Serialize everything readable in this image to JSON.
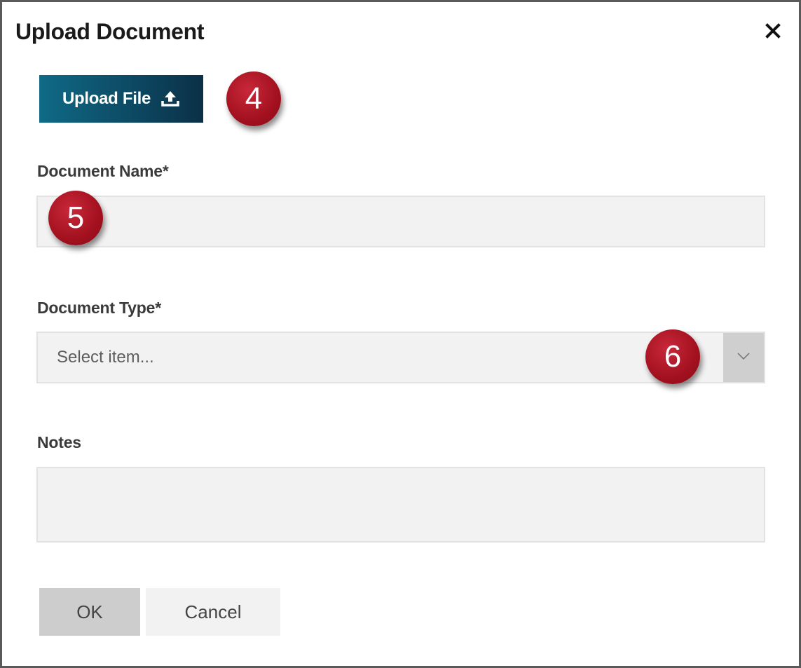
{
  "dialog": {
    "title": "Upload Document",
    "close_glyph": "✕"
  },
  "upload": {
    "label": "Upload File",
    "icon": "upload-icon"
  },
  "fields": {
    "document_name": {
      "label": "Document Name*",
      "value": ""
    },
    "document_type": {
      "label": "Document Type*",
      "placeholder": "Select item...",
      "icon": "chevron-down-icon"
    },
    "notes": {
      "label": "Notes",
      "value": ""
    }
  },
  "callouts": [
    "4",
    "5",
    "6"
  ],
  "buttons": {
    "ok": "OK",
    "cancel": "Cancel"
  },
  "colors": {
    "upload_button": "#0d4a64",
    "callout": "#a3111f"
  }
}
